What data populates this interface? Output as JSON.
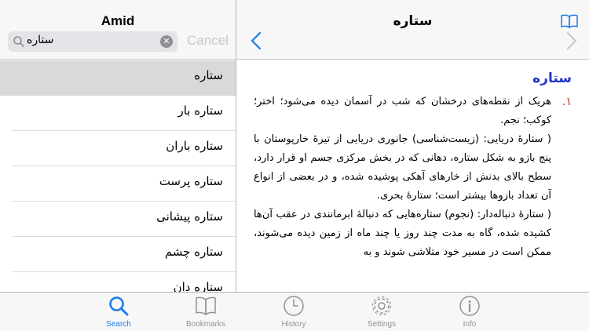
{
  "left": {
    "title": "Amid",
    "search": {
      "value": "ستاره",
      "cancel_label": "Cancel"
    },
    "results": [
      "ستاره",
      "ستاره بار",
      "ستاره باران",
      "ستاره پرست",
      "ستاره پیشانی",
      "ستاره چشم",
      "ستاره دان"
    ],
    "selected_index": 0
  },
  "right": {
    "title": "ستاره",
    "headword": "ستاره",
    "sense_number": "۱.",
    "definition": [
      "هریک از نقطه‌های درخشان که شب در آسمان دیده می‌شود؛ اختر؛ کوکب؛ نجم.",
      "( ستارهٔ دریایی: (زیست‌شناسی) جانوری دریایی از تیرهٔ خارپوستان با پنج بازو به شکل ستاره، دهانی که در بخش مرکزی جسم او قرار دارد، سطح بالای بدنش از خارهای آهکی پوشیده شده، و در بعضی از انواع آن تعداد بازوها بیشتر است؛ ستارهٔ بحری.",
      "( ستارهٔ دنباله‌دار: (نجوم) ستاره‌هایی که دنبالهٔ ابرمانندی در عقب آن‌ها کشیده شده، گاه به مدت چند روز یا چند ماه از زمین دیده می‌شوند، ممکن است در مسیر خود متلاشی شوند و به"
    ]
  },
  "tabs": [
    {
      "label": "Search",
      "icon": "search-icon",
      "active": true
    },
    {
      "label": "Bookmarks",
      "icon": "book-icon",
      "active": false
    },
    {
      "label": "History",
      "icon": "clock-icon",
      "active": false
    },
    {
      "label": "Settings",
      "icon": "gear-icon",
      "active": false
    },
    {
      "label": "Info",
      "icon": "info-icon",
      "active": false
    }
  ],
  "colors": {
    "accent": "#1a7de8",
    "headword": "#2137c8",
    "sense_number": "#c02525",
    "inactive": "#929292"
  }
}
